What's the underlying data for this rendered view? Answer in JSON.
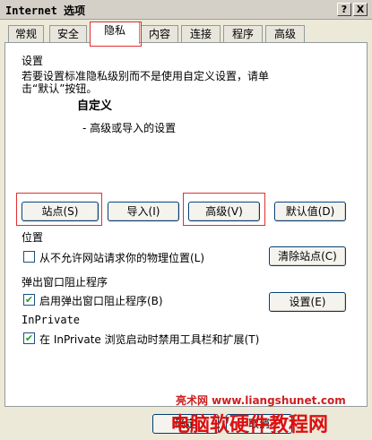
{
  "window": {
    "title": "Internet 选项",
    "help_btn": "?",
    "close_btn": "X"
  },
  "tabs": [
    {
      "label": "常规"
    },
    {
      "label": "安全"
    },
    {
      "label": "隐私"
    },
    {
      "label": "内容"
    },
    {
      "label": "连接"
    },
    {
      "label": "程序"
    },
    {
      "label": "高级"
    }
  ],
  "settings": {
    "group_label": "设置",
    "description": "若要设置标准隐私级别而不是使用自定义设置，请单击“默认”按钮。",
    "level": "自定义",
    "level_detail": "- 高级或导入的设置",
    "buttons": {
      "sites": "站点(S)",
      "import": "导入(I)",
      "advanced": "高级(V)",
      "default": "默认值(D)"
    }
  },
  "location": {
    "group_label": "位置",
    "checkbox_label": "从不允许网站请求你的物理位置(L)",
    "checked": false,
    "clear_btn": "清除站点(C)"
  },
  "popup": {
    "group_label": "弹出窗口阻止程序",
    "checkbox_label": "启用弹出窗口阻止程序(B)",
    "checked": true,
    "settings_btn": "设置(E)"
  },
  "inprivate": {
    "group_label": "InPrivate",
    "checkbox_label": "在 InPrivate 浏览启动时禁用工具栏和扩展(T)",
    "checked": true
  },
  "footer": {
    "ok": "确定",
    "cancel": "取消"
  },
  "watermark": {
    "line1": "亮术网 www.liangshunet.com",
    "line2": "电脑软硬件教程网"
  },
  "check_mark": "✔"
}
